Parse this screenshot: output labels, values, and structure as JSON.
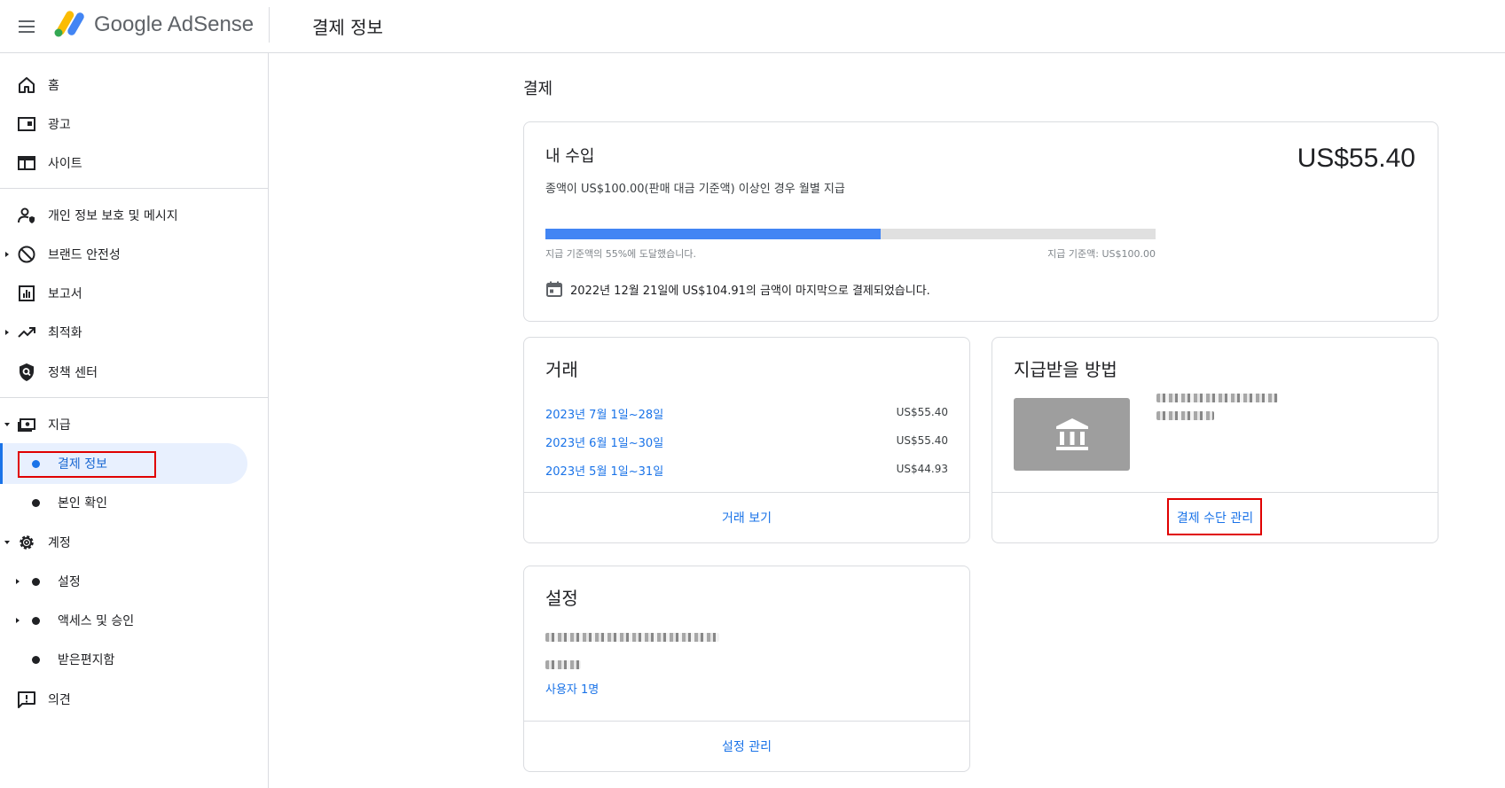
{
  "app": {
    "brand": "Google AdSense",
    "page_title": "결제 정보"
  },
  "sidebar": {
    "items": [
      {
        "label": "홈",
        "icon": "home-icon"
      },
      {
        "label": "광고",
        "icon": "ads-icon"
      },
      {
        "label": "사이트",
        "icon": "sites-icon"
      },
      {
        "label": "개인 정보 보호 및 메시지",
        "icon": "privacy-icon"
      },
      {
        "label": "브랜드 안전성",
        "icon": "block-icon"
      },
      {
        "label": "보고서",
        "icon": "report-icon"
      },
      {
        "label": "최적화",
        "icon": "trending-icon"
      },
      {
        "label": "정책 센터",
        "icon": "policy-shield-icon"
      },
      {
        "label": "지급",
        "icon": "payments-icon"
      },
      {
        "label": "결제 정보"
      },
      {
        "label": "본인 확인"
      },
      {
        "label": "계정",
        "icon": "gear-icon"
      },
      {
        "label": "설정"
      },
      {
        "label": "액세스 및 승인"
      },
      {
        "label": "받은편지함"
      },
      {
        "label": "의견",
        "icon": "feedback-icon"
      }
    ]
  },
  "main": {
    "section_title": "결제",
    "earnings": {
      "title": "내 수입",
      "subtitle": "종액이 US$100.00(판매 대금 기준액) 이상인 경우 월별 지급",
      "amount": "US$55.40",
      "progress_fraction": 0.55,
      "progress_left": "지급 기준액의 55%에 도달했습니다.",
      "progress_right": "지급 기준액: US$100.00",
      "last_payment": "2022년 12월 21일에 US$104.91의 금액이 마지막으로 결제되었습니다."
    },
    "transactions": {
      "title": "거래",
      "rows": [
        {
          "period": "2023년 7월 1일~28일",
          "amount": "US$55.40"
        },
        {
          "period": "2023년 6월 1일~30일",
          "amount": "US$55.40"
        },
        {
          "period": "2023년 5월 1일~31일",
          "amount": "US$44.93"
        }
      ],
      "footer_link": "거래 보기"
    },
    "payment_method": {
      "title": "지급받을 방법",
      "footer_link": "결제 수단 관리"
    },
    "settings": {
      "title": "설정",
      "users_link": "사용자 1명",
      "footer_link": "설정 관리"
    }
  },
  "colors": {
    "accent": "#1a73e8",
    "progress": "#4285f4",
    "highlight_box": "#e00000"
  }
}
